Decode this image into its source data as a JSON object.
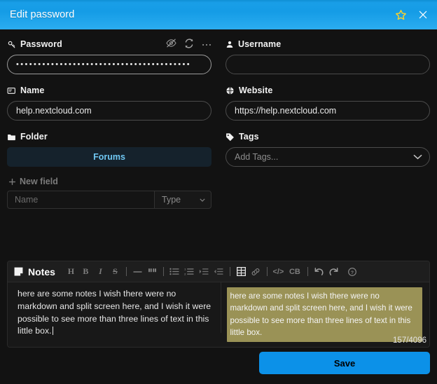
{
  "window": {
    "title": "Edit password",
    "favorite_icon": "star-icon",
    "close_icon": "close-icon"
  },
  "form": {
    "password": {
      "label": "Password",
      "icon": "key-icon",
      "value": "••••••••••••••••••••••••••••••••••••••••",
      "actions": [
        {
          "name": "toggle-password-visibility-icon",
          "glyph": "eye-slash"
        },
        {
          "name": "regenerate-password-icon",
          "glyph": "refresh"
        },
        {
          "name": "password-more-options-icon",
          "glyph": "ellipsis"
        }
      ]
    },
    "username": {
      "label": "Username",
      "icon": "user-icon",
      "value": "",
      "placeholder": ""
    },
    "name": {
      "label": "Name",
      "icon": "label-icon",
      "value": "help.nextcloud.com"
    },
    "website": {
      "label": "Website",
      "icon": "globe-icon",
      "value": "https://help.nextcloud.com"
    },
    "folder": {
      "label": "Folder",
      "icon": "folder-icon",
      "selected": "Forums"
    },
    "tags": {
      "label": "Tags",
      "icon": "tag-icon",
      "placeholder": "Add Tags...",
      "chevron": "chevron-down-icon"
    },
    "new_field": {
      "label": "New field",
      "plus_icon": "plus-icon",
      "name_placeholder": "Name",
      "type_placeholder": "Type",
      "chevron": "chevron-down-icon"
    }
  },
  "notes": {
    "title": "Notes",
    "icon": "note-icon",
    "toolbar": [
      {
        "name": "heading-button",
        "glyph": "H",
        "type": "text"
      },
      {
        "name": "bold-button",
        "glyph": "B",
        "type": "text"
      },
      {
        "name": "italic-button",
        "glyph": "I",
        "type": "italic"
      },
      {
        "name": "strikethrough-button",
        "glyph": "S",
        "type": "strike"
      },
      {
        "name": "separator-1",
        "glyph": "",
        "type": "sep"
      },
      {
        "name": "horizontal-rule-button",
        "glyph": "—",
        "type": "text"
      },
      {
        "name": "blockquote-button",
        "glyph": "❝",
        "type": "text"
      },
      {
        "name": "separator-2",
        "glyph": "",
        "type": "sep"
      },
      {
        "name": "bullet-list-button",
        "glyph": "☰",
        "type": "bullet"
      },
      {
        "name": "numbered-list-button",
        "glyph": "☰",
        "type": "numbered"
      },
      {
        "name": "indent-button",
        "glyph": "▸",
        "type": "indent"
      },
      {
        "name": "outdent-button",
        "glyph": "◂",
        "type": "outdent"
      },
      {
        "name": "separator-3",
        "glyph": "",
        "type": "sep"
      },
      {
        "name": "table-button",
        "glyph": "▦",
        "type": "table"
      },
      {
        "name": "link-button",
        "glyph": "🔗",
        "type": "link"
      },
      {
        "name": "separator-4",
        "glyph": "",
        "type": "sep"
      },
      {
        "name": "inline-code-button",
        "glyph": "</>",
        "type": "code"
      },
      {
        "name": "code-block-button",
        "glyph": "CB",
        "type": "text"
      },
      {
        "name": "separator-5",
        "glyph": "",
        "type": "sep"
      },
      {
        "name": "undo-button",
        "glyph": "↺",
        "type": "undo"
      },
      {
        "name": "redo-button",
        "glyph": "↻",
        "type": "redo"
      },
      {
        "name": "help-button",
        "glyph": "?",
        "type": "help"
      }
    ],
    "editor_text": "here are some notes I wish there were no markdown and split screen here, and I wish it were possible to see more than three lines of text in this little box.",
    "preview_text": "here are some notes I wish there were no markdown and split screen here, and I wish it were possible to see more than three lines of text in this little box.",
    "character_count": "157/4096",
    "preview_highlight_color": "#9a9256"
  },
  "footer": {
    "save_label": "Save",
    "save_color": "#0c91e8"
  }
}
